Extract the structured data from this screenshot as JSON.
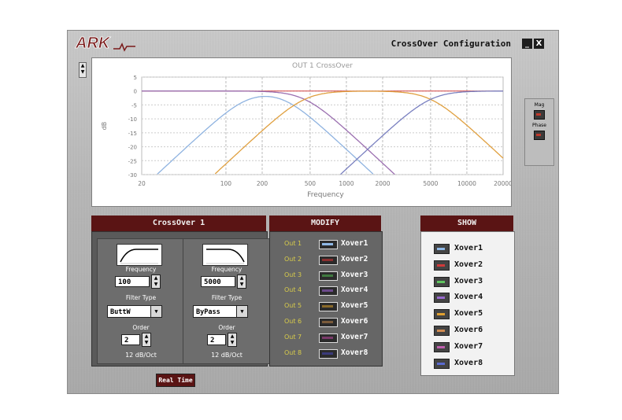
{
  "window": {
    "title": "CrossOver Configuration",
    "logo_text": "ARK",
    "minimize_label": "_",
    "close_label": "X"
  },
  "graph": {
    "title": "OUT 1 CrossOver",
    "xlabel": "Frequency",
    "ylabel": "dB",
    "y_ticks": [
      "5",
      "0",
      "-5",
      "-10",
      "-15",
      "-20",
      "-25",
      "-30"
    ],
    "x_ticks": [
      "20",
      "100",
      "200",
      "500",
      "1000",
      "2000",
      "5000",
      "10000",
      "20000"
    ]
  },
  "side": {
    "mag_label": "Mag",
    "phase_label": "Phase"
  },
  "crossover": {
    "header": "CrossOver 1",
    "low": {
      "frequency_label": "Frequency",
      "frequency": "100",
      "filter_type_label": "Filter Type",
      "filter_type": "ButtW",
      "order_label": "Order",
      "order": "2",
      "slope": "12 dB/Oct"
    },
    "high": {
      "frequency_label": "Frequency",
      "frequency": "5000",
      "filter_type_label": "Filter Type",
      "filter_type": "ByPass",
      "order_label": "Order",
      "order": "2",
      "slope": "12 dB/Oct"
    }
  },
  "modify": {
    "header": "MODIFY",
    "rows": [
      {
        "out": "Out 1",
        "name": "Xover1",
        "color": "#8fb8e6"
      },
      {
        "out": "Out 2",
        "name": "Xover2",
        "color": "#8a2f2f"
      },
      {
        "out": "Out 3",
        "name": "Xover3",
        "color": "#3f7a3f"
      },
      {
        "out": "Out 4",
        "name": "Xover4",
        "color": "#6b4a8a"
      },
      {
        "out": "Out 5",
        "name": "Xover5",
        "color": "#8a6a2a"
      },
      {
        "out": "Out 6",
        "name": "Xover6",
        "color": "#7a5a3a"
      },
      {
        "out": "Out 7",
        "name": "Xover7",
        "color": "#7a3a6a"
      },
      {
        "out": "Out 8",
        "name": "Xover8",
        "color": "#3a3a7a"
      }
    ]
  },
  "show": {
    "header": "SHOW",
    "rows": [
      {
        "name": "Xover1",
        "color": "#8fb8e6"
      },
      {
        "name": "Xover2",
        "color": "#d03b3b"
      },
      {
        "name": "Xover3",
        "color": "#5fc45f"
      },
      {
        "name": "Xover4",
        "color": "#9a6ad0"
      },
      {
        "name": "Xover5",
        "color": "#e0a030"
      },
      {
        "name": "Xover6",
        "color": "#d08a50"
      },
      {
        "name": "Xover7",
        "color": "#c060b0"
      },
      {
        "name": "Xover8",
        "color": "#5a6ad0"
      }
    ]
  },
  "realtime_label": "Real Time"
}
